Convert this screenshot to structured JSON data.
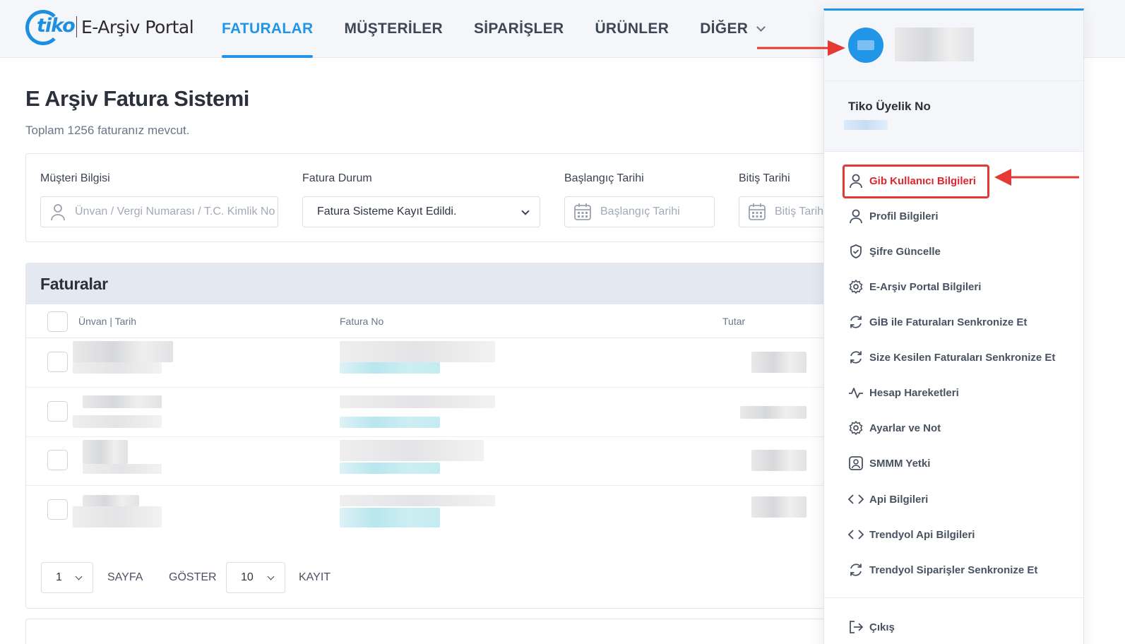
{
  "logo": {
    "mark": "tiko",
    "text": "E-Arşiv Portal"
  },
  "nav": [
    {
      "label": "FATURALAR",
      "active": true
    },
    {
      "label": "MÜŞTERİLER"
    },
    {
      "label": "SİPARİŞLER"
    },
    {
      "label": "ÜRÜNLER"
    },
    {
      "label": "DİĞER",
      "dropdown": true
    }
  ],
  "page": {
    "title": "E Arşiv Fatura Sistemi",
    "subtitle": "Toplam 1256 faturanız mevcut."
  },
  "filters": {
    "customer": {
      "label": "Müşteri Bilgisi",
      "placeholder": "Ünvan / Vergi Numarası / T.C. Kimlik No"
    },
    "status": {
      "label": "Fatura Durum",
      "value": "Fatura Sisteme Kayıt Edildi."
    },
    "start_date": {
      "label": "Başlangıç Tarihi",
      "placeholder": "Başlangıç Tarihi"
    },
    "end_date": {
      "label": "Bitiş Tarihi",
      "placeholder": "Bitiş Tarihi"
    }
  },
  "invoices": {
    "title": "Faturalar",
    "columns": [
      "Ünvan | Tarih",
      "Fatura No",
      "Tutar"
    ],
    "row_count": 4
  },
  "pagination": {
    "page": "1",
    "page_label": "SAYFA",
    "show_label": "GÖSTER",
    "per_page": "10",
    "record_label": "KAYIT"
  },
  "user_menu": {
    "member_label": "Tiko Üyelik No",
    "items": [
      {
        "label": "Gib Kullanıcı Bilgileri",
        "icon": "user-icon",
        "highlighted": true
      },
      {
        "label": "Profil Bilgileri",
        "icon": "user-icon"
      },
      {
        "label": "Şifre Güncelle",
        "icon": "shield-check-icon"
      },
      {
        "label": "E-Arşiv Portal Bilgileri",
        "icon": "gear-icon"
      },
      {
        "label": "GİB ile Faturaları Senkronize Et",
        "icon": "sync-icon"
      },
      {
        "label": "Size Kesilen Faturaları Senkronize Et",
        "icon": "sync-icon"
      },
      {
        "label": "Hesap Hareketleri",
        "icon": "activity-icon"
      },
      {
        "label": "Ayarlar ve Not",
        "icon": "gear-icon"
      },
      {
        "label": "SMMM Yetki",
        "icon": "user-badge-icon"
      },
      {
        "label": "Api Bilgileri",
        "icon": "code-icon"
      },
      {
        "label": "Trendyol Api Bilgileri",
        "icon": "code-icon"
      },
      {
        "label": "Trendyol Siparişler Senkronize Et",
        "icon": "sync-icon"
      }
    ],
    "logout": {
      "label": "Çıkış",
      "icon": "logout-icon"
    }
  },
  "colors": {
    "primary": "#2196e8",
    "highlight": "#e53935",
    "annotation_arrow": "#e53935"
  }
}
